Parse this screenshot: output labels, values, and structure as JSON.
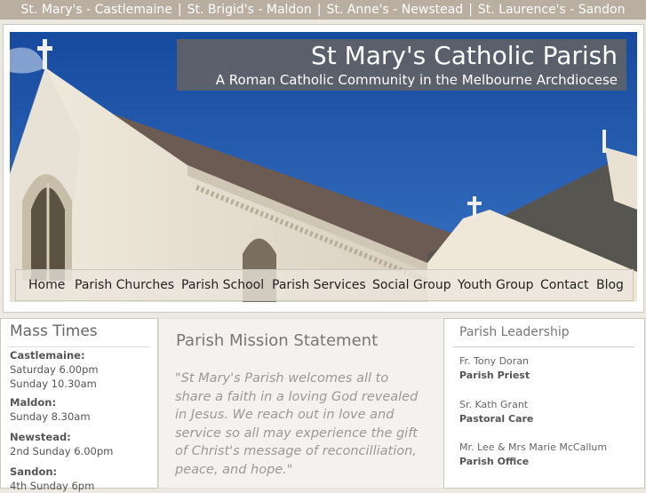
{
  "topbar": {
    "churches": [
      "St. Mary's - Castlemaine",
      "St. Brigid's - Maldon",
      "St. Anne's - Newstead",
      "St. Laurence's - Sandon"
    ],
    "separator": "|"
  },
  "header": {
    "title": "St Mary's Catholic Parish",
    "subtitle": "A Roman Catholic Community in the Melbourne Archdiocese"
  },
  "nav": {
    "items": [
      "Home",
      "Parish Churches",
      "Parish School",
      "Parish Services",
      "Social Group",
      "Youth Group",
      "Contact",
      "Blog"
    ]
  },
  "mass_times": {
    "heading": "Mass Times",
    "groups": [
      {
        "place": "Castlemaine:",
        "times": [
          "Saturday 6.00pm",
          "Sunday 10.30am"
        ]
      },
      {
        "place": "Maldon:",
        "times": [
          "Sunday 8.30am"
        ]
      },
      {
        "place": "Newstead:",
        "times": [
          "2nd Sunday 6.00pm"
        ]
      },
      {
        "place": "Sandon:",
        "times": [
          "4th Sunday 6pm"
        ]
      }
    ]
  },
  "mission": {
    "heading": "Parish Mission Statement",
    "text": "\"St Mary's Parish welcomes all to share a faith in a loving God revealed in Jesus. We reach out in love and service so all may experience the gift of Christ's message of reconcilliation, peace, and hope.\""
  },
  "leadership": {
    "heading": "Parish Leadership",
    "people": [
      {
        "name": "Fr. Tony Doran",
        "role": "Parish Priest"
      },
      {
        "name": "Sr. Kath Grant",
        "role": "Pastoral Care"
      },
      {
        "name": "Mr. Lee & Mrs Marie McCallum",
        "role": "Parish Office"
      }
    ]
  },
  "colors": {
    "topbar": "#b9aea0",
    "sky": "#1d4fa0",
    "title_overlay": "#69645f"
  }
}
